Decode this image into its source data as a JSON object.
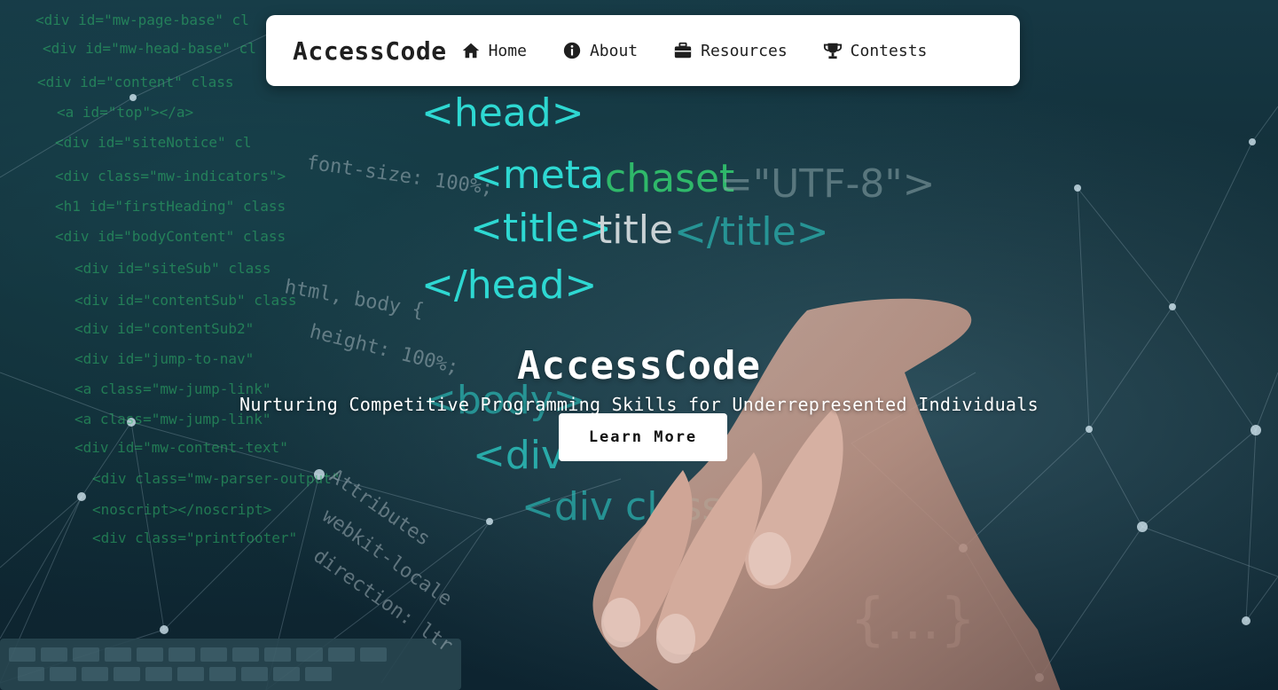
{
  "navbar": {
    "brand": "AccessCode",
    "items": [
      {
        "label": "Home",
        "icon": "home-icon"
      },
      {
        "label": "About",
        "icon": "info-icon"
      },
      {
        "label": "Resources",
        "icon": "briefcase-icon"
      },
      {
        "label": "Contests",
        "icon": "trophy-icon"
      }
    ]
  },
  "hero": {
    "title": "AccessCode",
    "subtitle": "Nurturing Competitive Programming Skills for Underrepresented Individuals",
    "cta_label": "Learn More",
    "code_lines": [
      "<head>",
      "<meta",
      "chaset",
      "=\"UTF-8\">",
      "<title>",
      "title",
      "</title>",
      "</head>",
      "<body>",
      "<div",
      "<div class",
      "{...}"
    ],
    "side_code": [
      "<div id=\"mw-page-base\" cl",
      "<div id=\"mw-head-base\" cl",
      "<div id=\"content\" class",
      "<a id=\"top\"></a>",
      "<div id=\"siteNotice\" cl",
      "<div class=\"mw-indicators\">",
      "<h1 id=\"firstHeading\" class",
      "<div id=\"bodyContent\" class",
      "<div id=\"siteSub\" class",
      "<div id=\"contentSub\" class",
      "<div id=\"contentSub2\"",
      "<div id=\"jump-to-nav\"",
      "<a class=\"mw-jump-link\"",
      "<a class=\"mw-jump-link\"",
      "<div id=\"mw-content-text\"",
      "<div class=\"mw-parser-output\"",
      "<noscript></noscript>",
      "<div class=\"printfooter\""
    ],
    "css_fragments": [
      "font-size: 100%;",
      "html, body {",
      "height: 100%;",
      "Attributes",
      "webkit-locale",
      "direction: ltr"
    ],
    "colors": {
      "cyan": "#2ed8d2",
      "green": "#2fb86a",
      "gray": "#9aa6aa"
    }
  }
}
